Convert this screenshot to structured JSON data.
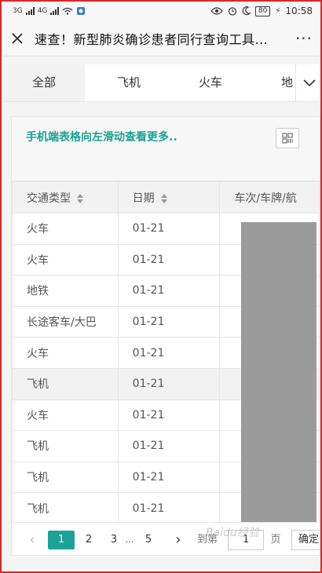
{
  "status_bar": {
    "left_labels": [
      "3G",
      "4G"
    ],
    "battery": "80",
    "time": "10:58"
  },
  "title_bar": {
    "title": "速查！新型肺炎确诊患者同行查询工具...",
    "more_label": "···"
  },
  "tabs": [
    "全部",
    "飞机",
    "火车",
    "地"
  ],
  "hint": "手机端表格向左滑动查看更多..",
  "table": {
    "headers": [
      "交通类型",
      "日期",
      "车次/车牌/航"
    ],
    "rows": [
      [
        "火车",
        "01-21"
      ],
      [
        "火车",
        "01-21"
      ],
      [
        "地铁",
        "01-21"
      ],
      [
        "长途客车/大巴",
        "01-21"
      ],
      [
        "火车",
        "01-21"
      ],
      [
        "飞机",
        "01-21"
      ],
      [
        "火车",
        "01-21"
      ],
      [
        "飞机",
        "01-21"
      ],
      [
        "飞机",
        "01-21"
      ],
      [
        "飞机",
        "01-21"
      ]
    ],
    "highlighted_row": 5
  },
  "pagination": {
    "prev": "‹",
    "pages": [
      "1",
      "2",
      "3",
      "...",
      "5"
    ],
    "current": "1",
    "next": "›",
    "goto_label": "到第",
    "goto_value": "1",
    "page_unit": "页",
    "confirm": "确定"
  },
  "watermark": "Baidu经验",
  "colors": {
    "accent": "#1aa394",
    "frame": "#d9262c",
    "redaction": "#9b9b9b"
  }
}
